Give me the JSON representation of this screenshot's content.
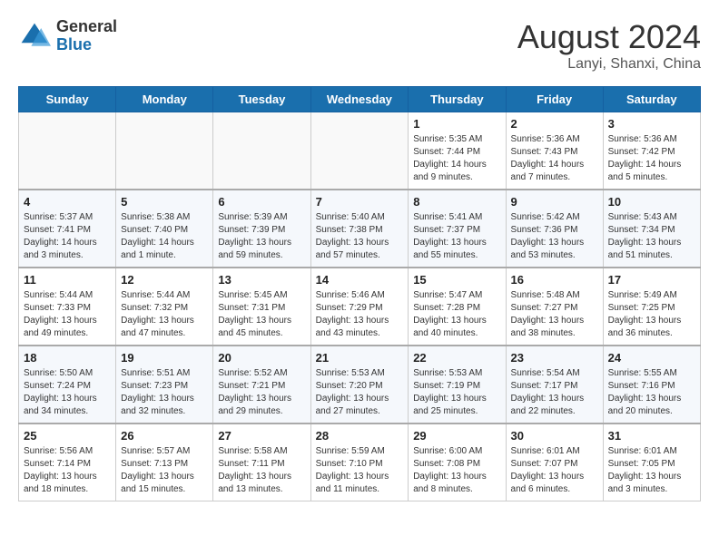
{
  "header": {
    "logo_general": "General",
    "logo_blue": "Blue",
    "month_year": "August 2024",
    "location": "Lanyi, Shanxi, China"
  },
  "calendar": {
    "days_of_week": [
      "Sunday",
      "Monday",
      "Tuesday",
      "Wednesday",
      "Thursday",
      "Friday",
      "Saturday"
    ],
    "weeks": [
      [
        {
          "day": "",
          "info": ""
        },
        {
          "day": "",
          "info": ""
        },
        {
          "day": "",
          "info": ""
        },
        {
          "day": "",
          "info": ""
        },
        {
          "day": "1",
          "info": "Sunrise: 5:35 AM\nSunset: 7:44 PM\nDaylight: 14 hours\nand 9 minutes."
        },
        {
          "day": "2",
          "info": "Sunrise: 5:36 AM\nSunset: 7:43 PM\nDaylight: 14 hours\nand 7 minutes."
        },
        {
          "day": "3",
          "info": "Sunrise: 5:36 AM\nSunset: 7:42 PM\nDaylight: 14 hours\nand 5 minutes."
        }
      ],
      [
        {
          "day": "4",
          "info": "Sunrise: 5:37 AM\nSunset: 7:41 PM\nDaylight: 14 hours\nand 3 minutes."
        },
        {
          "day": "5",
          "info": "Sunrise: 5:38 AM\nSunset: 7:40 PM\nDaylight: 14 hours\nand 1 minute."
        },
        {
          "day": "6",
          "info": "Sunrise: 5:39 AM\nSunset: 7:39 PM\nDaylight: 13 hours\nand 59 minutes."
        },
        {
          "day": "7",
          "info": "Sunrise: 5:40 AM\nSunset: 7:38 PM\nDaylight: 13 hours\nand 57 minutes."
        },
        {
          "day": "8",
          "info": "Sunrise: 5:41 AM\nSunset: 7:37 PM\nDaylight: 13 hours\nand 55 minutes."
        },
        {
          "day": "9",
          "info": "Sunrise: 5:42 AM\nSunset: 7:36 PM\nDaylight: 13 hours\nand 53 minutes."
        },
        {
          "day": "10",
          "info": "Sunrise: 5:43 AM\nSunset: 7:34 PM\nDaylight: 13 hours\nand 51 minutes."
        }
      ],
      [
        {
          "day": "11",
          "info": "Sunrise: 5:44 AM\nSunset: 7:33 PM\nDaylight: 13 hours\nand 49 minutes."
        },
        {
          "day": "12",
          "info": "Sunrise: 5:44 AM\nSunset: 7:32 PM\nDaylight: 13 hours\nand 47 minutes."
        },
        {
          "day": "13",
          "info": "Sunrise: 5:45 AM\nSunset: 7:31 PM\nDaylight: 13 hours\nand 45 minutes."
        },
        {
          "day": "14",
          "info": "Sunrise: 5:46 AM\nSunset: 7:29 PM\nDaylight: 13 hours\nand 43 minutes."
        },
        {
          "day": "15",
          "info": "Sunrise: 5:47 AM\nSunset: 7:28 PM\nDaylight: 13 hours\nand 40 minutes."
        },
        {
          "day": "16",
          "info": "Sunrise: 5:48 AM\nSunset: 7:27 PM\nDaylight: 13 hours\nand 38 minutes."
        },
        {
          "day": "17",
          "info": "Sunrise: 5:49 AM\nSunset: 7:25 PM\nDaylight: 13 hours\nand 36 minutes."
        }
      ],
      [
        {
          "day": "18",
          "info": "Sunrise: 5:50 AM\nSunset: 7:24 PM\nDaylight: 13 hours\nand 34 minutes."
        },
        {
          "day": "19",
          "info": "Sunrise: 5:51 AM\nSunset: 7:23 PM\nDaylight: 13 hours\nand 32 minutes."
        },
        {
          "day": "20",
          "info": "Sunrise: 5:52 AM\nSunset: 7:21 PM\nDaylight: 13 hours\nand 29 minutes."
        },
        {
          "day": "21",
          "info": "Sunrise: 5:53 AM\nSunset: 7:20 PM\nDaylight: 13 hours\nand 27 minutes."
        },
        {
          "day": "22",
          "info": "Sunrise: 5:53 AM\nSunset: 7:19 PM\nDaylight: 13 hours\nand 25 minutes."
        },
        {
          "day": "23",
          "info": "Sunrise: 5:54 AM\nSunset: 7:17 PM\nDaylight: 13 hours\nand 22 minutes."
        },
        {
          "day": "24",
          "info": "Sunrise: 5:55 AM\nSunset: 7:16 PM\nDaylight: 13 hours\nand 20 minutes."
        }
      ],
      [
        {
          "day": "25",
          "info": "Sunrise: 5:56 AM\nSunset: 7:14 PM\nDaylight: 13 hours\nand 18 minutes."
        },
        {
          "day": "26",
          "info": "Sunrise: 5:57 AM\nSunset: 7:13 PM\nDaylight: 13 hours\nand 15 minutes."
        },
        {
          "day": "27",
          "info": "Sunrise: 5:58 AM\nSunset: 7:11 PM\nDaylight: 13 hours\nand 13 minutes."
        },
        {
          "day": "28",
          "info": "Sunrise: 5:59 AM\nSunset: 7:10 PM\nDaylight: 13 hours\nand 11 minutes."
        },
        {
          "day": "29",
          "info": "Sunrise: 6:00 AM\nSunset: 7:08 PM\nDaylight: 13 hours\nand 8 minutes."
        },
        {
          "day": "30",
          "info": "Sunrise: 6:01 AM\nSunset: 7:07 PM\nDaylight: 13 hours\nand 6 minutes."
        },
        {
          "day": "31",
          "info": "Sunrise: 6:01 AM\nSunset: 7:05 PM\nDaylight: 13 hours\nand 3 minutes."
        }
      ]
    ]
  }
}
